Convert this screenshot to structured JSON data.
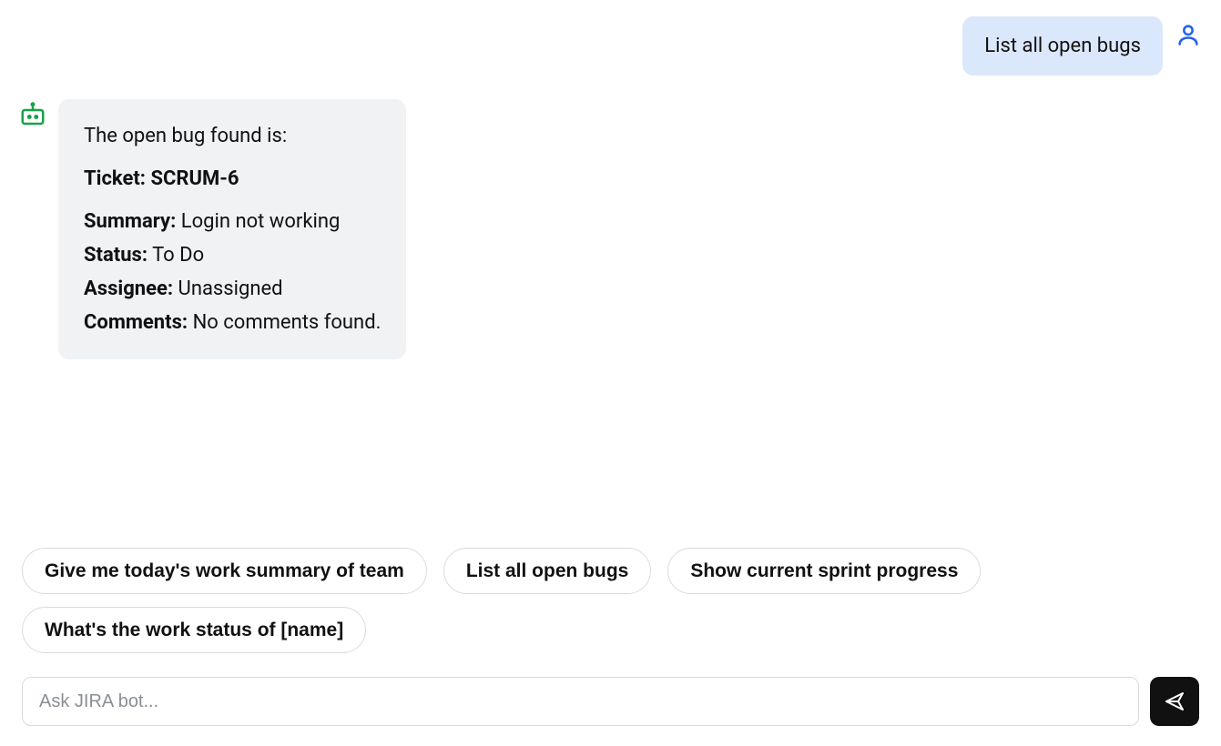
{
  "messages": {
    "user_0": "List all open bugs",
    "bot_0": {
      "intro": "The open bug found is:",
      "ticket_label": "Ticket:",
      "ticket_value": "SCRUM-6",
      "summary_label": "Summary:",
      "summary_value": "Login not working",
      "status_label": "Status:",
      "status_value": "To Do",
      "assignee_label": "Assignee:",
      "assignee_value": "Unassigned",
      "comments_label": "Comments:",
      "comments_value": "No comments found."
    }
  },
  "suggestions": {
    "s0": "Give me today's work summary of team",
    "s1": "List all open bugs",
    "s2": "Show current sprint progress",
    "s3": "What's the work status of [name]"
  },
  "input": {
    "placeholder": "Ask JIRA bot..."
  },
  "colors": {
    "user_bubble_bg": "#dbe7fb",
    "bot_bubble_bg": "#f1f2f3",
    "send_bg": "#111111",
    "accent_user_icon": "#2563eb",
    "accent_bot_icon": "#16a34a"
  }
}
